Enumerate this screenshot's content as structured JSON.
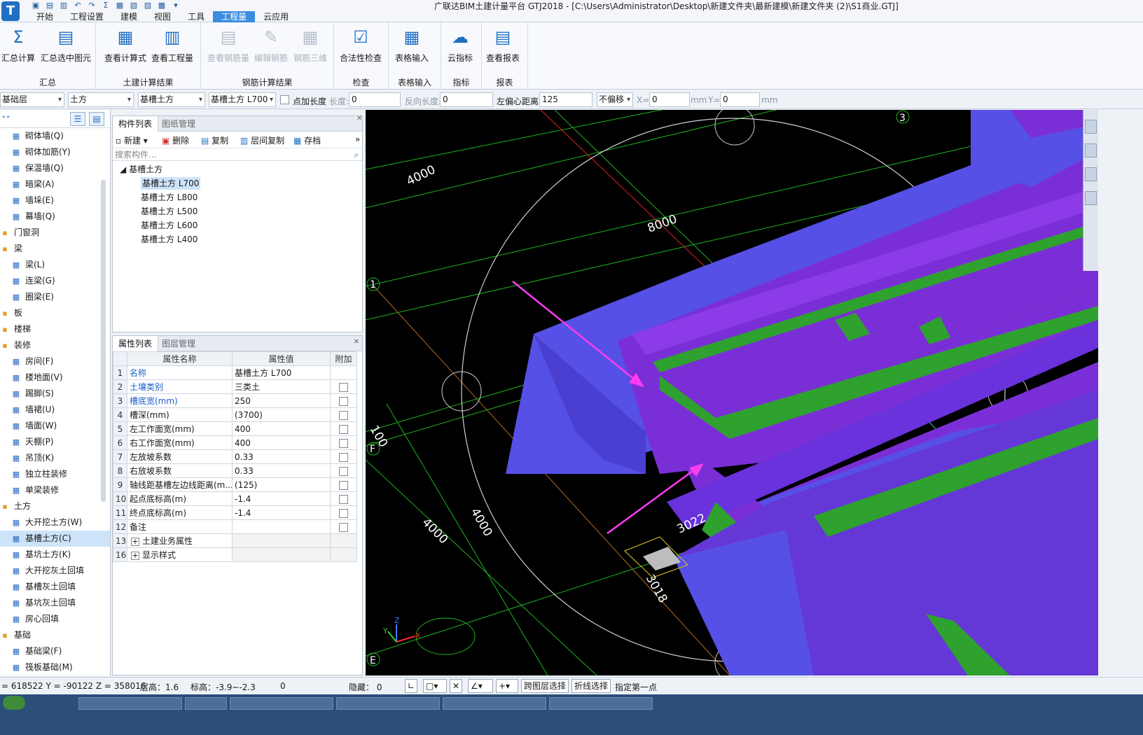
{
  "window": {
    "title": "广联达BIM土建计量平台 GTJ2018 - [C:\\Users\\Administrator\\Desktop\\新建文件夹\\最新建模\\新建文件夹 (2)\\S1商业.GTJ]",
    "logo_letter": "T"
  },
  "menu_tabs": [
    "开始",
    "工程设置",
    "建模",
    "视图",
    "工具",
    "工程量",
    "云应用"
  ],
  "active_tab": "工程量",
  "ribbon": {
    "groups": [
      {
        "label": "汇总",
        "buttons": [
          {
            "label": "汇总计算",
            "icon": "sum-icon"
          },
          {
            "label": "汇总选中图元",
            "icon": "sum-selected-icon"
          }
        ]
      },
      {
        "label": "土建计算结果",
        "buttons": [
          {
            "label": "查看计算式",
            "icon": "view-formula-icon"
          },
          {
            "label": "查看工程量",
            "icon": "view-quantity-icon"
          }
        ]
      },
      {
        "label": "钢筋计算结果",
        "buttons": [
          {
            "label": "查看钢筋量",
            "icon": "rebar-quantity-icon"
          },
          {
            "label": "编辑钢筋",
            "icon": "edit-rebar-icon"
          },
          {
            "label": "钢筋三维",
            "icon": "rebar-3d-icon"
          }
        ]
      },
      {
        "label": "检查",
        "buttons": [
          {
            "label": "合法性检查",
            "icon": "validity-check-icon"
          }
        ]
      },
      {
        "label": "表格输入",
        "buttons": [
          {
            "label": "表格输入",
            "icon": "table-input-icon"
          }
        ]
      },
      {
        "label": "指标",
        "buttons": [
          {
            "label": "云指标",
            "icon": "cloud-index-icon"
          }
        ]
      },
      {
        "label": "报表",
        "buttons": [
          {
            "label": "查看报表",
            "icon": "view-report-icon"
          }
        ]
      }
    ]
  },
  "toolbar2": {
    "floor": "基础层",
    "category": "土方",
    "type": "基槽土方",
    "component": "基槽土方 L700",
    "point_length_label": "点加长度",
    "length_label": "长度:",
    "length_value": "0",
    "reverse_length_label": "反向长度:",
    "reverse_length_value": "0",
    "left_offset_label": "左偏心距离:",
    "left_offset_value": "125",
    "offset_mode": "不偏移",
    "x_label": "X=",
    "x_value": "0",
    "x_unit": "mm",
    "y_label": "Y=",
    "y_value": "0",
    "y_unit": "mm"
  },
  "tree": [
    {
      "label": "砌体墙(Q)",
      "level": 1,
      "icon": "wall-icon"
    },
    {
      "label": "砌体加筋(Y)",
      "level": 1,
      "icon": "wall-rebar-icon"
    },
    {
      "label": "保温墙(Q)",
      "level": 1,
      "icon": "insulation-wall-icon"
    },
    {
      "label": "暗梁(A)",
      "level": 1,
      "icon": "hidden-beam-icon"
    },
    {
      "label": "墙垛(E)",
      "level": 1,
      "icon": "wall-pier-icon"
    },
    {
      "label": "幕墙(Q)",
      "level": 1,
      "icon": "curtain-wall-icon"
    },
    {
      "label": "门窗洞",
      "level": 0,
      "icon": "door-window-icon"
    },
    {
      "label": "梁",
      "level": 0,
      "icon": "beam-folder-icon"
    },
    {
      "label": "梁(L)",
      "level": 1,
      "icon": "beam-icon"
    },
    {
      "label": "连梁(G)",
      "level": 1,
      "icon": "link-beam-icon"
    },
    {
      "label": "圈梁(E)",
      "level": 1,
      "icon": "ring-beam-icon"
    },
    {
      "label": "板",
      "level": 0,
      "icon": "slab-folder-icon"
    },
    {
      "label": "楼梯",
      "level": 0,
      "icon": "stair-folder-icon"
    },
    {
      "label": "装修",
      "level": 0,
      "icon": "decoration-folder-icon"
    },
    {
      "label": "房间(F)",
      "level": 1,
      "icon": "room-icon"
    },
    {
      "label": "楼地面(V)",
      "level": 1,
      "icon": "floor-icon"
    },
    {
      "label": "踢脚(S)",
      "level": 1,
      "icon": "skirting-icon"
    },
    {
      "label": "墙裙(U)",
      "level": 1,
      "icon": "dado-icon"
    },
    {
      "label": "墙面(W)",
      "level": 1,
      "icon": "wall-face-icon"
    },
    {
      "label": "天棚(P)",
      "level": 1,
      "icon": "ceiling-icon"
    },
    {
      "label": "吊顶(K)",
      "level": 1,
      "icon": "suspended-ceiling-icon"
    },
    {
      "label": "独立柱装修",
      "level": 1,
      "icon": "column-decoration-icon"
    },
    {
      "label": "单梁装修",
      "level": 1,
      "icon": "beam-decoration-icon"
    },
    {
      "label": "土方",
      "level": 0,
      "icon": "earthwork-folder-icon"
    },
    {
      "label": "大开挖土方(W)",
      "level": 1,
      "icon": "excavation-icon"
    },
    {
      "label": "基槽土方(C)",
      "level": 1,
      "icon": "trench-icon",
      "selected": true
    },
    {
      "label": "基坑土方(K)",
      "level": 1,
      "icon": "pit-icon"
    },
    {
      "label": "大开挖灰土回填",
      "level": 1,
      "icon": "excavation-backfill-icon"
    },
    {
      "label": "基槽灰土回填",
      "level": 1,
      "icon": "trench-backfill-icon"
    },
    {
      "label": "基坑灰土回填",
      "level": 1,
      "icon": "pit-backfill-icon"
    },
    {
      "label": "房心回填",
      "level": 1,
      "icon": "room-backfill-icon"
    },
    {
      "label": "基础",
      "level": 0,
      "icon": "foundation-folder-icon"
    },
    {
      "label": "基础梁(F)",
      "level": 1,
      "icon": "foundation-beam-icon"
    },
    {
      "label": "筏板基础(M)",
      "level": 1,
      "icon": "raft-icon"
    }
  ],
  "component_panel": {
    "tabs": [
      "构件列表",
      "图纸管理"
    ],
    "actions": [
      "新建",
      "删除",
      "复制",
      "层间复制",
      "存档"
    ],
    "search_placeholder": "搜索构件...",
    "group": "基槽土方",
    "items": [
      "基槽土方 L700",
      "基槽土方 L800",
      "基槽土方 L500",
      "基槽土方 L600",
      "基槽土方 L400"
    ],
    "selected": "基槽土方 L700"
  },
  "property_panel": {
    "tabs": [
      "属性列表",
      "图层管理"
    ],
    "headers": [
      "属性名称",
      "属性值",
      "附加"
    ],
    "rows": [
      {
        "num": "1",
        "name": "名称",
        "value": "基槽土方 L700",
        "blue": true,
        "check": false
      },
      {
        "num": "2",
        "name": "土壤类别",
        "value": "三类土",
        "blue": true,
        "check": true
      },
      {
        "num": "3",
        "name": "槽底宽(mm)",
        "value": "250",
        "blue": true,
        "check": true
      },
      {
        "num": "4",
        "name": "槽深(mm)",
        "value": "(3700)",
        "blue": false,
        "check": true
      },
      {
        "num": "5",
        "name": "左工作面宽(mm)",
        "value": "400",
        "blue": false,
        "check": true
      },
      {
        "num": "6",
        "name": "右工作面宽(mm)",
        "value": "400",
        "blue": false,
        "check": true
      },
      {
        "num": "7",
        "name": "左放坡系数",
        "value": "0.33",
        "blue": false,
        "check": true
      },
      {
        "num": "8",
        "name": "右放坡系数",
        "value": "0.33",
        "blue": false,
        "check": true
      },
      {
        "num": "9",
        "name": "轴线距基槽左边线距离(m...",
        "value": "(125)",
        "blue": false,
        "check": true
      },
      {
        "num": "10",
        "name": "起点底标高(m)",
        "value": "-1.4",
        "blue": false,
        "check": true
      },
      {
        "num": "11",
        "name": "终点底标高(m)",
        "value": "-1.4",
        "blue": false,
        "check": true
      },
      {
        "num": "12",
        "name": "备注",
        "value": "",
        "blue": false,
        "check": true
      },
      {
        "num": "13",
        "name": "土建业务属性",
        "value": "",
        "blue": false,
        "check": false,
        "expand": true
      },
      {
        "num": "16",
        "name": "显示样式",
        "value": "",
        "blue": false,
        "check": false,
        "expand": true
      }
    ]
  },
  "viewport": {
    "axis_labels": [
      "3",
      "1",
      "F",
      "E"
    ],
    "dimensions": [
      "4000",
      "8000",
      "100",
      "4000",
      "4000",
      "3022",
      "3018"
    ],
    "colors": {
      "purple": "#7a2fd6",
      "blue_purple": "#5650e6",
      "green": "#2fa12f",
      "pink": "#ff3cf0",
      "grid": "#19b819"
    }
  },
  "status": {
    "coords": "= 618522 Y = -90122 Z = 358016",
    "floor_height": "层高：1.6",
    "elevation": "标高：-3.9~-2.3",
    "zero": "0",
    "hidden": "隐藏： 0",
    "cross_layer": "跨图层选择",
    "polyline": "折线选择",
    "hint": "指定第一点"
  }
}
